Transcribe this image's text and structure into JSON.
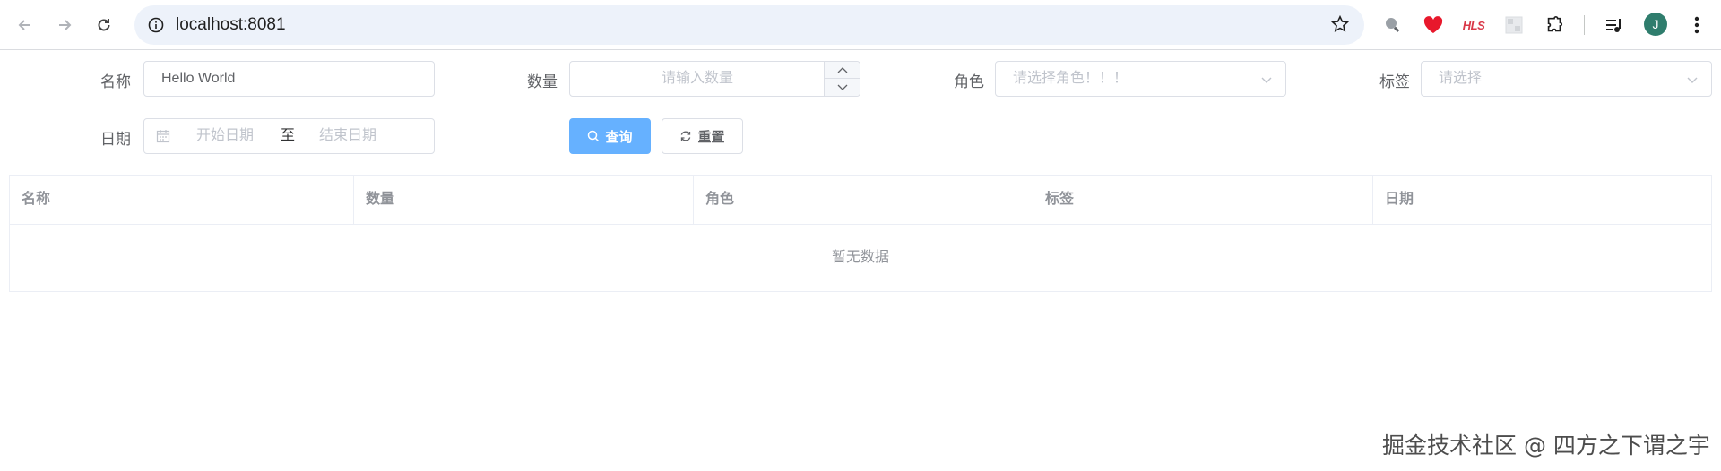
{
  "browser": {
    "url": "localhost:8081",
    "avatar_letter": "J",
    "hls_label": "HLS"
  },
  "form": {
    "name_label": "名称",
    "name_value": "Hello World",
    "quantity_label": "数量",
    "quantity_placeholder": "请输入数量",
    "role_label": "角色",
    "role_placeholder": "请选择角色！！！",
    "tag_label": "标签",
    "tag_placeholder": "请选择",
    "date_label": "日期",
    "date_start_placeholder": "开始日期",
    "date_separator": "至",
    "date_end_placeholder": "结束日期",
    "query_button": "查询",
    "reset_button": "重置"
  },
  "table": {
    "columns": [
      "名称",
      "数量",
      "角色",
      "标签",
      "日期"
    ],
    "empty_text": "暂无数据"
  },
  "watermark": "掘金技术社区 @ 四方之下谓之宇",
  "colors": {
    "primary_button": "#66b1ff",
    "border": "#dcdfe6",
    "placeholder": "#c0c4cc",
    "avatar": "#2f7d6d"
  }
}
